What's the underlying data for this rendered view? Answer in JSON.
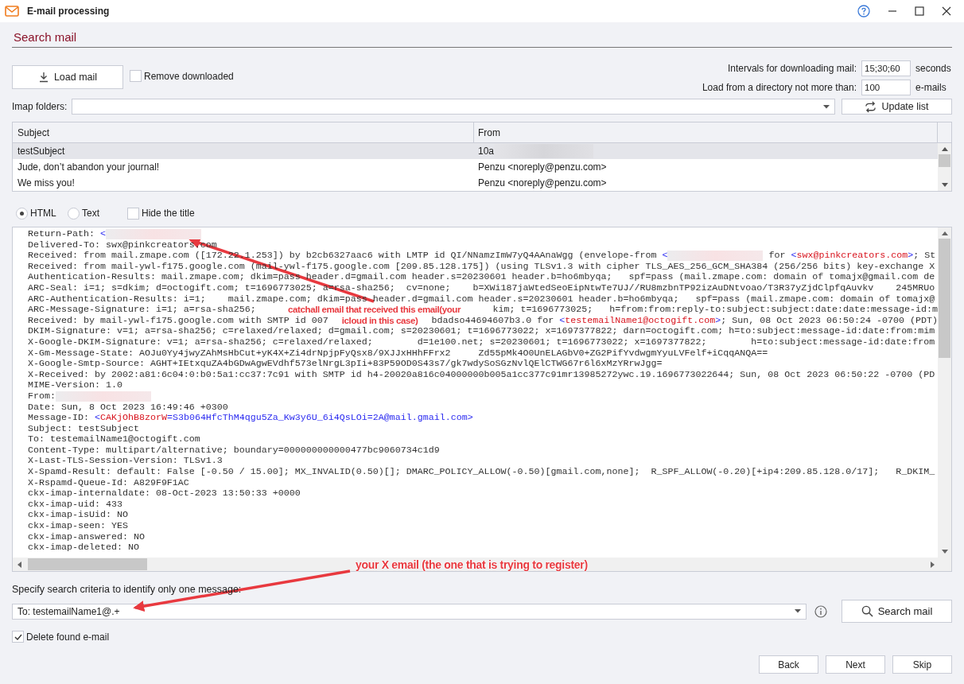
{
  "window": {
    "title": "E-mail processing"
  },
  "section_title": "Search mail",
  "load_button": "Load mail",
  "remove_downloaded": {
    "label": "Remove downloaded",
    "checked": false
  },
  "intervals": {
    "label": "Intervals for downloading mail:",
    "value": "15;30;60",
    "unit": "seconds"
  },
  "directory_limit": {
    "label": "Load from a directory not more than:",
    "value": "100",
    "unit": "e-mails"
  },
  "imap_folders": {
    "label": "Imap folders:"
  },
  "update_button": "Update list",
  "table": {
    "columns": [
      "Subject",
      "From"
    ],
    "rows": [
      {
        "subject": "testSubject",
        "from": [
          {
            "text": "10a",
            "kind": "plain"
          },
          {
            "kind": "redacted"
          }
        ],
        "selected": true
      },
      {
        "subject": "Jude, don’t abandon your journal!",
        "from": [
          {
            "text": "Penzu <noreply@penzu.com>",
            "kind": "plain"
          }
        ],
        "selected": false
      },
      {
        "subject": "We miss you!",
        "from": [
          {
            "text": "Penzu <noreply@penzu.com>",
            "kind": "plain"
          }
        ],
        "selected": false
      }
    ]
  },
  "view_modes": [
    {
      "label": "HTML",
      "selected": true
    },
    {
      "label": "Text",
      "selected": false
    }
  ],
  "hide_title": {
    "label": "Hide the title",
    "checked": false
  },
  "header_lines": [
    {
      "parts": [
        {
          "text": "Return-Path: ",
          "kind": "plain"
        },
        {
          "text": "<",
          "kind": "tag"
        },
        {
          "kind": "redacted"
        }
      ]
    },
    {
      "parts": [
        {
          "text": "Delivered-To: swx@pinkcreators.com",
          "kind": "plain"
        }
      ]
    },
    {
      "parts": [
        {
          "text": "Received: from mail.zmape.com ([172.22.1.253]) by b2cb6327aac6 with LMTP id QI/NNamzImW7yQ4AAnaWgg (envelope-from ",
          "kind": "plain"
        },
        {
          "text": "<",
          "kind": "tag"
        },
        {
          "kind": "redacted"
        },
        {
          "text": " for ",
          "kind": "plain"
        },
        {
          "text": "<",
          "kind": "tag"
        },
        {
          "text": "swx@pinkcreators.com",
          "kind": "addr"
        },
        {
          "text": ">",
          "kind": "tag"
        },
        {
          "text": "; St",
          "kind": "plain"
        }
      ]
    },
    {
      "parts": [
        {
          "text": "Received: from mail-ywl-f175.google.com (mail-ywl-f175.google.com [209.85.128.175]) (using TLSv1.3 with cipher TLS_AES_256_GCM_SHA384 (256/256 bits) key-exchange X",
          "kind": "plain"
        }
      ]
    },
    {
      "parts": [
        {
          "text": "Authentication-Results: mail.zmape.com; dkim=pass header.d=gmail.com header.s=20230601 header.b=ho6mbyqa;   spf=pass (mail.zmape.com: domain of tomajx@gmail.com de",
          "kind": "plain"
        }
      ]
    },
    {
      "parts": [
        {
          "text": "ARC-Seal: i=1; s=dkim; d=octogift.com; t=1696773025; a=rsa-sha256;  cv=none;    b=XWi187jaWtedSeoEipNtwTe7UJ//RU8mzbnTP92izAuDNtvoao/T3R37yZjdClpfqAuvkv    245MRUo",
          "kind": "plain"
        }
      ]
    },
    {
      "parts": [
        {
          "text": "ARC-Authentication-Results: i=1;    mail.zmape.com; dkim=pass header.d=gmail.com header.s=20230601 header.b=ho6mbyqa;   spf=pass (mail.zmape.com: domain of tomajx@",
          "kind": "plain"
        }
      ]
    },
    {
      "parts": [
        {
          "text": "ARC-Message-Signature: i=1; a=rsa-sha256;",
          "kind": "plain"
        },
        {
          "kind": "callout",
          "text": "catchall email that received this email(your"
        },
        {
          "text": "kim; t=1696773025;   h=from:from:reply-to:subject:subject:date:date:message-id:m",
          "kind": "plain"
        }
      ]
    },
    {
      "parts": [
        {
          "text": "Received: by mail-ywl-f175.google.com with SMTP id 007",
          "kind": "plain"
        },
        {
          "kind": "callout",
          "text": "icloud in this case)"
        },
        {
          "text": "bdadso44694607b3.0 for ",
          "kind": "plain"
        },
        {
          "text": "<",
          "kind": "tag"
        },
        {
          "text": "testemailName1@octogift.com",
          "kind": "addr"
        },
        {
          "text": ">",
          "kind": "tag"
        },
        {
          "text": "; Sun, 08 Oct 2023 06:50:24 -0700 (PDT)",
          "kind": "plain"
        }
      ]
    },
    {
      "parts": [
        {
          "text": "DKIM-Signature: v=1; a=rsa-sha256; c=relaxed/relaxed; d=gmail.com; s=20230601; t=1696773022; x=1697377822; darn=octogift.com; h=to:subject:message-id:date:from:mim",
          "kind": "plain"
        }
      ]
    },
    {
      "parts": [
        {
          "text": "X-Google-DKIM-Signature: v=1; a=rsa-sha256; c=relaxed/relaxed;        d=1e100.net; s=20230601; t=1696773022; x=1697377822;        h=to:subject:message-id:date:from",
          "kind": "plain"
        }
      ]
    },
    {
      "parts": [
        {
          "text": "X-Gm-Message-State: AOJu0Yy4jwyZAhMsHbCut+yK4X+Zi4drNpjpFyQsx8/9XJJxHHhFFrx2     Zd55pMk4O0UnELAGbV0+ZG2PifYvdwgmYyuLVFelf+iCqqANQA==",
          "kind": "plain"
        }
      ]
    },
    {
      "parts": [
        {
          "text": "X-Google-Smtp-Source: AGHT+IEtxquZA4bGDwAgwEVdhf573elNrgL3pIi+83P59OD0S43s7/gk7wdySoSGzNvlQElCTWG67r6l6xMzYRrwJgg=",
          "kind": "plain"
        }
      ]
    },
    {
      "parts": [
        {
          "text": "X-Received: by 2002:a81:6c04:0:b0:5a1:cc37:7c91 with SMTP id h4-20020a816c04000000b005a1cc377c91mr13985272ywc.19.1696773022644; Sun, 08 Oct 2023 06:50:22 -0700 (PD",
          "kind": "plain"
        }
      ]
    },
    {
      "parts": [
        {
          "text": "MIME-Version: 1.0",
          "kind": "plain"
        }
      ]
    },
    {
      "parts": [
        {
          "text": "From:",
          "kind": "plain"
        },
        {
          "kind": "redacted"
        }
      ]
    },
    {
      "parts": [
        {
          "text": "Date: Sun, 8 Oct 2023 16:49:46 +0300",
          "kind": "plain"
        }
      ]
    },
    {
      "parts": [
        {
          "text": "Message-ID: ",
          "kind": "plain"
        },
        {
          "text": "<",
          "kind": "tag"
        },
        {
          "text": "CAKjOhB8zorW",
          "kind": "addr"
        },
        {
          "text": "=S3b064HfcThM4qgu5Za_Kw3y6U_6i4QsLOi=2A@mail.gmail.com>",
          "kind": "tag"
        }
      ]
    },
    {
      "parts": [
        {
          "text": "Subject: testSubject",
          "kind": "plain"
        }
      ]
    },
    {
      "parts": [
        {
          "text": "To: testemailName1@octogift.com",
          "kind": "plain"
        }
      ]
    },
    {
      "parts": [
        {
          "text": "Content-Type: multipart/alternative; boundary=000000000000477bc9060734c1d9",
          "kind": "plain"
        }
      ]
    },
    {
      "parts": [
        {
          "text": "X-Last-TLS-Session-Version: TLSv1.3",
          "kind": "plain"
        }
      ]
    },
    {
      "parts": [
        {
          "text": "X-Spamd-Result: default: False [-0.50 / 15.00]; MX_INVALID(0.50)[]; DMARC_POLICY_ALLOW(-0.50)[gmail.com,none];  R_SPF_ALLOW(-0.20)[+ip4:209.85.128.0/17];   R_DKIM_",
          "kind": "plain"
        }
      ]
    },
    {
      "parts": [
        {
          "text": "X-Rspamd-Queue-Id: A829F9F1AC",
          "kind": "plain"
        }
      ]
    },
    {
      "parts": [
        {
          "text": "ckx-imap-internaldate: 08-Oct-2023 13:50:33 +0000",
          "kind": "plain"
        }
      ]
    },
    {
      "parts": [
        {
          "text": "ckx-imap-uid: 433",
          "kind": "plain"
        }
      ]
    },
    {
      "parts": [
        {
          "text": "ckx-imap-isUid: NO",
          "kind": "plain"
        }
      ]
    },
    {
      "parts": [
        {
          "text": "ckx-imap-seen: YES",
          "kind": "plain"
        }
      ]
    },
    {
      "parts": [
        {
          "text": "ckx-imap-answered: NO",
          "kind": "plain"
        }
      ]
    },
    {
      "parts": [
        {
          "text": "ckx-imap-deleted: NO",
          "kind": "plain"
        }
      ]
    }
  ],
  "criteria": {
    "label": "Specify search criteria to identify only one message:",
    "value": "To: testemailName1@.+"
  },
  "search_button": "Search mail",
  "delete_found": {
    "label": "Delete found e-mail",
    "checked": true
  },
  "footer_buttons": [
    "Back",
    "Next",
    "Skip"
  ],
  "annotations": [
    {
      "text": "your X email (the one that is trying to register)"
    }
  ]
}
